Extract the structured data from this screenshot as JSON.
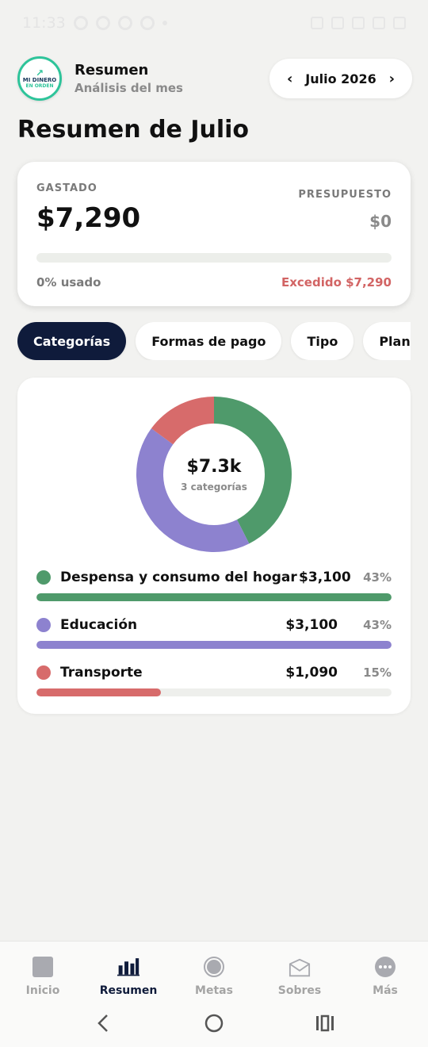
{
  "status_bar": {
    "time": "11:33"
  },
  "header": {
    "logo": {
      "line1": "MI DINERO",
      "line2": "EN ORDEN"
    },
    "title": "Resumen",
    "subtitle": "Análisis del mes",
    "month_label": "Julio 2026",
    "prev_icon": "chevron-left-icon",
    "next_icon": "chevron-right-icon"
  },
  "page_title": "Resumen de Julio",
  "summary": {
    "spent_label": "GASTADO",
    "spent_amount": "$7,290",
    "budget_label": "PRESUPUESTO",
    "budget_amount": "$0",
    "used_text": "0% usado",
    "used_fraction": 0,
    "exceeded_text": "Excedido $7,290",
    "exceeded_color": "#d26464"
  },
  "tabs": [
    {
      "label": "Categorías",
      "active": true
    },
    {
      "label": "Formas de pago",
      "active": false
    },
    {
      "label": "Tipo",
      "active": false
    },
    {
      "label": "Plan vs re",
      "active": false
    }
  ],
  "chart_data": {
    "type": "pie",
    "center_total": "$7.3k",
    "center_subtitle": "3 categorías",
    "categories": [
      "Despensa y consumo del hogar",
      "Educación",
      "Transporte"
    ],
    "values": [
      3100,
      3100,
      1090
    ],
    "amount_labels": [
      "$3,100",
      "$3,100",
      "$1,090"
    ],
    "percent_labels": [
      "43%",
      "43%",
      "15%"
    ],
    "bar_fractions": [
      1.0,
      1.0,
      0.35
    ],
    "colors": [
      "#4f9a6b",
      "#8d82cf",
      "#d76b6b"
    ]
  },
  "bottom_nav": [
    {
      "label": "Inicio",
      "icon": "home-icon",
      "active": false
    },
    {
      "label": "Resumen",
      "icon": "bar-chart-icon",
      "active": true
    },
    {
      "label": "Metas",
      "icon": "target-icon",
      "active": false
    },
    {
      "label": "Sobres",
      "icon": "envelope-icon",
      "active": false
    },
    {
      "label": "Más",
      "icon": "more-icon",
      "active": false
    }
  ],
  "system_nav": {
    "back_icon": "back-icon",
    "home_icon": "home-circle-icon",
    "recents_icon": "recents-icon"
  }
}
